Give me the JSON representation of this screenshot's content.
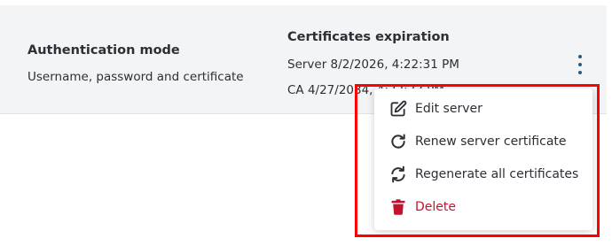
{
  "auth": {
    "title": "Authentication mode",
    "value": "Username, password and certificate"
  },
  "certificates": {
    "title": "Certificates expiration",
    "server": "Server 8/2/2026, 4:22:31 PM",
    "ca": "CA 4/27/2034, 4:22:33 PM"
  },
  "actions_menu": {
    "icon": "kebab-vertical-icon",
    "items": [
      {
        "label": "Edit server",
        "icon": "edit-icon"
      },
      {
        "label": "Renew server certificate",
        "icon": "refresh-icon"
      },
      {
        "label": "Regenerate all certificates",
        "icon": "sync-icon"
      },
      {
        "label": "Delete",
        "icon": "trash-icon",
        "color": "#c4122e"
      }
    ]
  },
  "colors": {
    "card_background": "#f3f4f6",
    "kebab": "#2d5a7b",
    "danger": "#c4122e",
    "highlight": "#ff0000"
  }
}
